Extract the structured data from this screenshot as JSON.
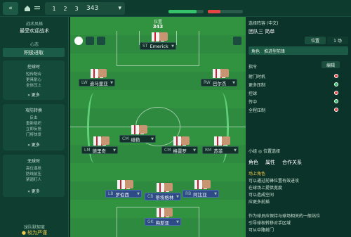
{
  "topbar": {
    "back_label": "«",
    "home_icon": "home-icon",
    "tabs": [
      "1",
      "2",
      "3"
    ],
    "formation": "343",
    "bar_left_label": "",
    "bar_mid_label": "",
    "stamina_label": "",
    "accent": "#35c26b",
    "warning": "#e34545"
  },
  "left": {
    "header_label": "战术风格",
    "header_value": "最受欢迎战术",
    "mentality_label": "心态",
    "mentality_value": "积极进取",
    "in_possession_title": "控球时",
    "in_possession_lines": [
      "短传配合",
      "更具耐心",
      "全体压上"
    ],
    "in_possession_btn": "» 更多",
    "in_transition_title": "攻防转换",
    "in_transition_lines": [
      "反击",
      "重新组织",
      "立即反抢",
      "门将快发"
    ],
    "in_transition_btn": "» 更多",
    "out_possession_title": "无球时",
    "out_possession_lines": [
      "高位逼抢",
      "防线前压",
      "紧逼盯人"
    ],
    "out_possession_btn": "» 更多",
    "bottom_label": "球队默契度",
    "bottom_value": "● 较为严谨"
  },
  "pitch": {
    "top_label": "位置",
    "top_formation": "343",
    "players": [
      {
        "pos": "ST",
        "name": "Emerick",
        "gk": false
      },
      {
        "pos": "LW",
        "name": "迪马里亚",
        "gk": false
      },
      {
        "pos": "RW",
        "name": "巴尔杰",
        "gk": false
      },
      {
        "pos": "LM",
        "name": "德里奇",
        "gk": false
      },
      {
        "pos": "CM",
        "name": "维勒",
        "gk": false
      },
      {
        "pos": "CM",
        "name": "格雷罗",
        "gk": false
      },
      {
        "pos": "RM",
        "name": "苏菲",
        "gk": false
      },
      {
        "pos": "LB",
        "name": "罗伯西",
        "gk": false
      },
      {
        "pos": "CB",
        "name": "蒂埃格林",
        "gk": false
      },
      {
        "pos": "RB",
        "name": "阿比亚",
        "gk": false
      },
      {
        "pos": "GK",
        "name": "梅斯亚",
        "gk": true
      }
    ]
  },
  "right": {
    "title": "选择阵容 (中文)",
    "team": "团队三 简单",
    "pos_tab": "位置",
    "stats_tab": "1 场",
    "role_label": "角色",
    "role_value": "推进型前锋",
    "list_title": "指令",
    "edit_btn": "编辑",
    "list_items": [
      "射门时机",
      "更多压制",
      "控球",
      "传中",
      "全程压制"
    ],
    "scout_label": "小组  ◎  位置选择",
    "bottom_tabs": [
      "角色",
      "属性",
      "合作关系"
    ],
    "desc": [
      "场上角色",
      "可以通过前锋位置有效进攻",
      "在球场上提供宽度",
      "可以造成空间",
      "应更多前插",
      "作为球员应保持与球场相关的一般站位",
      "引导球权转移对手区域",
      "可从中路射门"
    ]
  }
}
